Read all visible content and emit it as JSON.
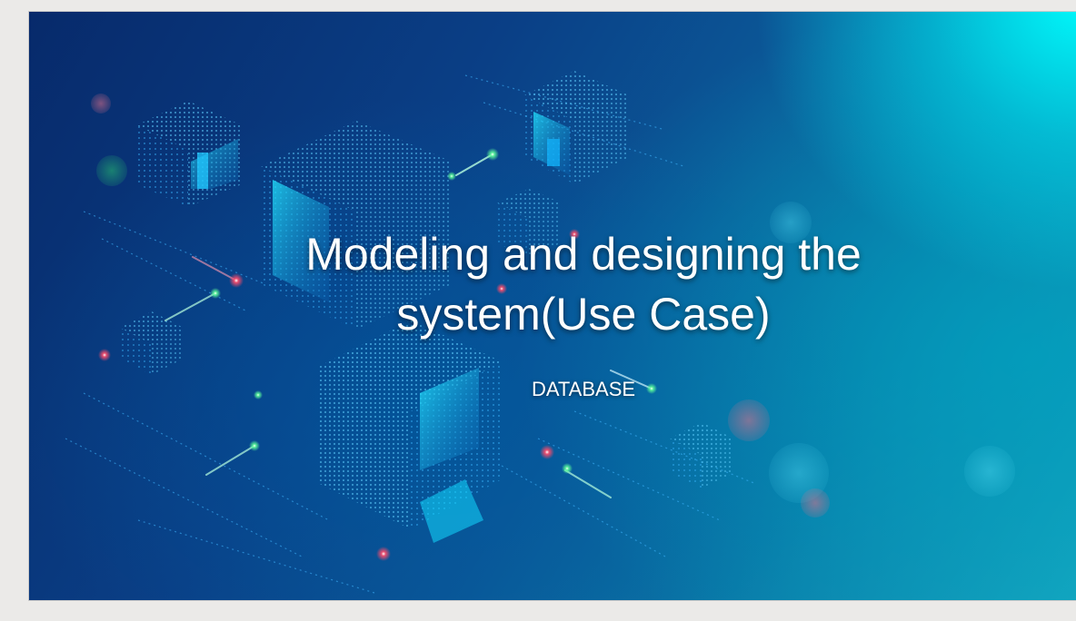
{
  "slide": {
    "title": "Modeling and designing the\nsystem(Use Case)",
    "subtitle": "DATABASE",
    "background_image": "digital-data-cubes-illustration"
  },
  "colors": {
    "frame_bg": "#ebeae8",
    "slide_deep_blue": "#072a6b",
    "slide_cyan": "#00ffff",
    "text": "#ffffff"
  }
}
